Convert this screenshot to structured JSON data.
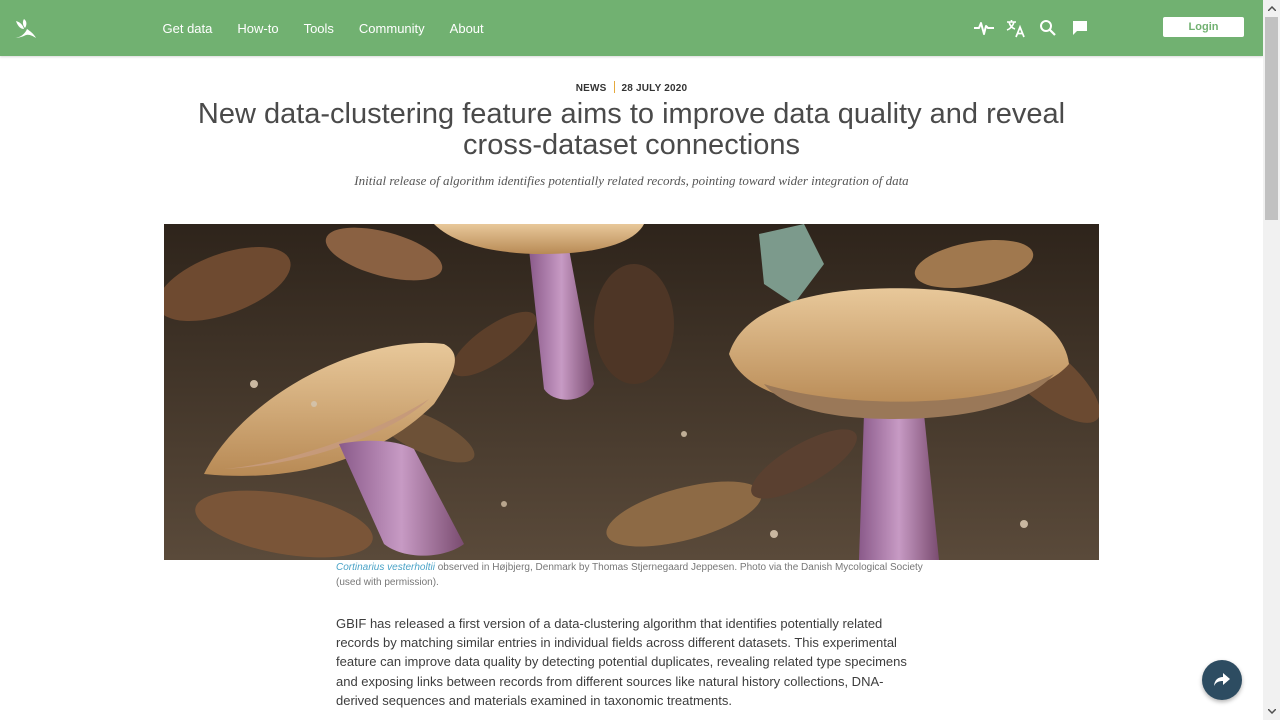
{
  "nav": {
    "items": [
      {
        "label": "Get data"
      },
      {
        "label": "How-to"
      },
      {
        "label": "Tools"
      },
      {
        "label": "Community"
      },
      {
        "label": "About"
      }
    ],
    "tools": [
      "pulse-icon",
      "translate-icon",
      "search-icon",
      "feedback-icon"
    ],
    "login_label": "Login"
  },
  "article": {
    "category": "NEWS",
    "date": "28 JULY 2020",
    "title": "New data-clustering feature aims to improve data quality and reveal cross-dataset connections",
    "subtitle": "Initial release of algorithm identifies potentially related records, pointing toward wider integration of data",
    "caption": {
      "species": "Cortinarius vesterholtii",
      "text": " observed in Højbjerg, Denmark by Thomas Stjernegaard Jeppesen. Photo via the Danish Mycological Society (used with permission)."
    },
    "paragraph": "GBIF has released a first version of a data-clustering algorithm that identifies potentially related records by matching similar entries in individual fields across different datasets. This experimental feature can improve data quality by detecting potential duplicates, revealing related type specimens and exposing links between records from different sources like natural history collections, DNA-derived sequences and materials examined in taxonomic treatments."
  },
  "colors": {
    "brand": "#71b171",
    "share_button": "#2d4c61",
    "accent_separator": "#e5a93c",
    "caption_link": "#4aa3c7"
  }
}
